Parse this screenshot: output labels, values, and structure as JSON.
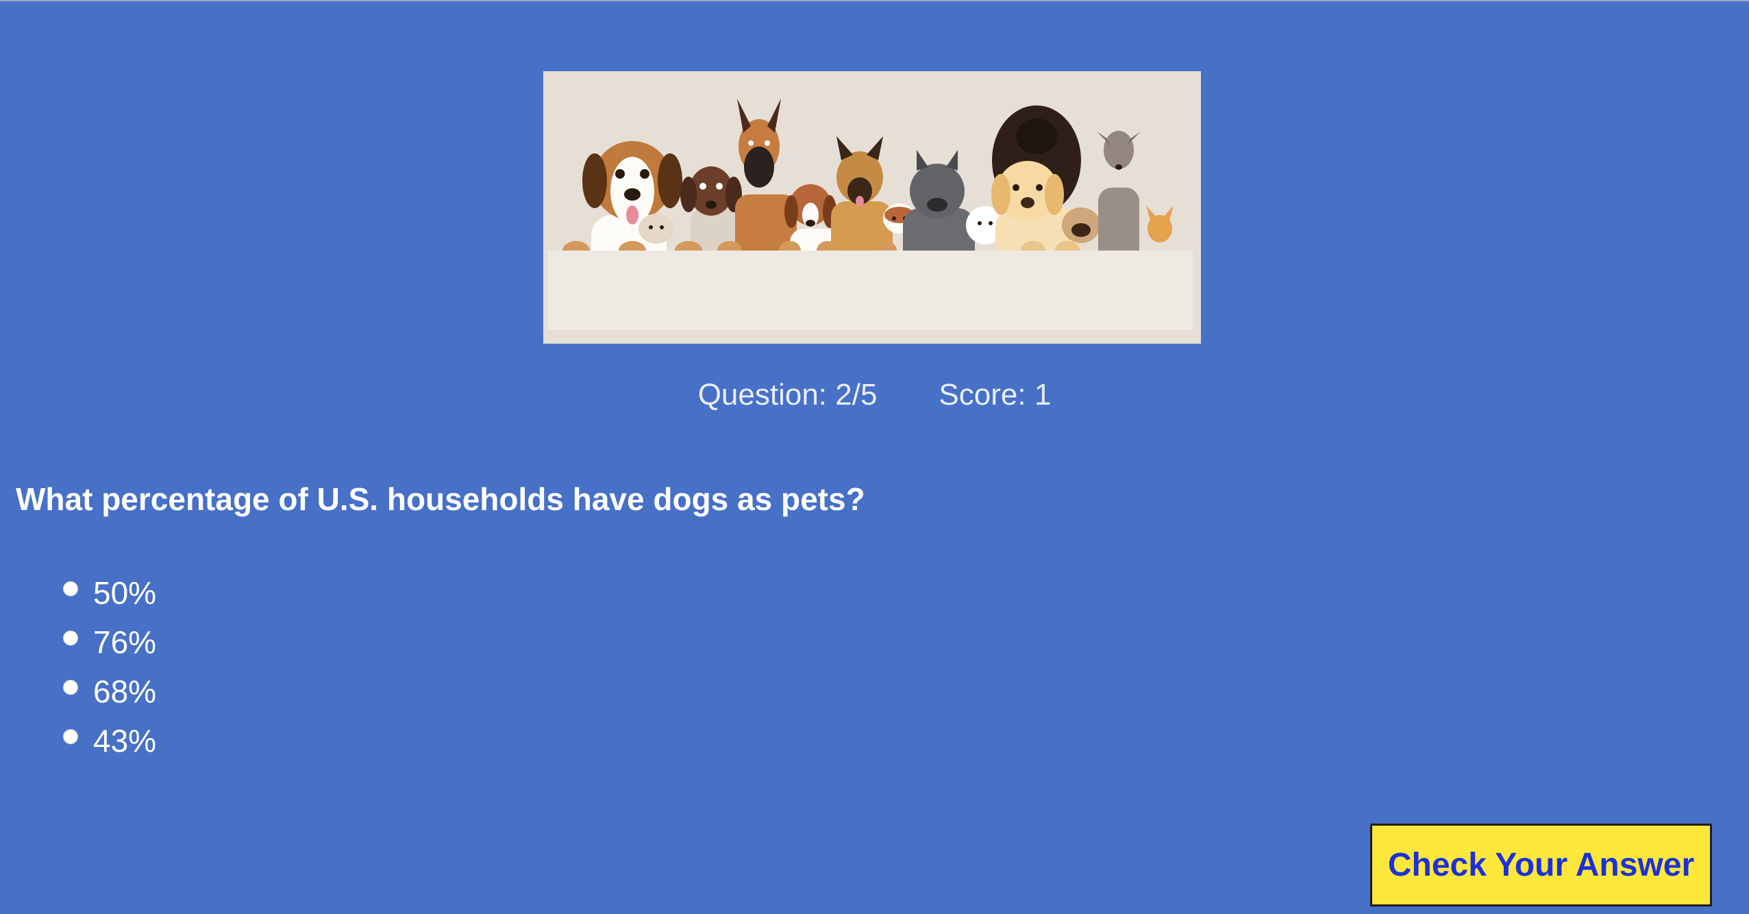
{
  "hero": {
    "image": "dogs-lineup-illustration"
  },
  "status": {
    "question_label": "Question: 2/5",
    "score_label": "Score: 1"
  },
  "question": {
    "text": "What percentage of U.S. households have dogs as pets?"
  },
  "options": [
    {
      "label": "50%"
    },
    {
      "label": "76%"
    },
    {
      "label": "68%"
    },
    {
      "label": "43%"
    }
  ],
  "actions": {
    "check_label": "Check Your Answer"
  },
  "colors": {
    "background": "#4770c7",
    "button_bg": "#fde73a",
    "button_text": "#1c31d9"
  }
}
